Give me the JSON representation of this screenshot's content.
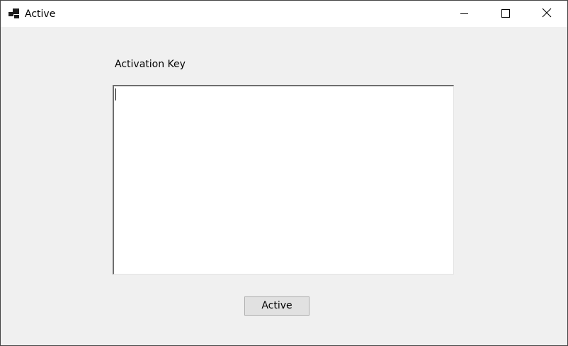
{
  "window": {
    "title": "Active",
    "icons": {
      "app": "app-icon",
      "minimize": "minimize-icon",
      "maximize": "maximize-icon",
      "close": "close-icon"
    }
  },
  "form": {
    "label": "Activation Key",
    "key_value": "",
    "button_label": "Active"
  },
  "colors": {
    "window_bg": "#f0f0f0",
    "titlebar_bg": "#ffffff",
    "button_bg": "#e1e1e1",
    "button_border": "#adadad"
  }
}
